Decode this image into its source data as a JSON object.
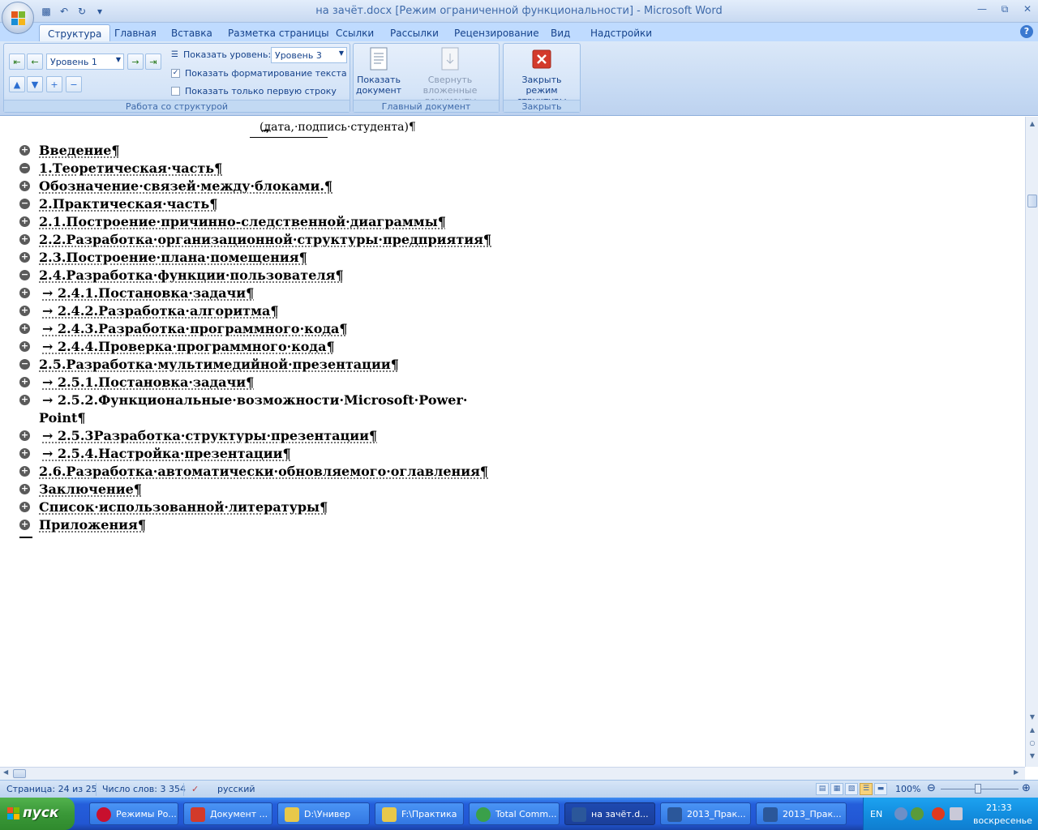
{
  "window": {
    "title": "на зачёт.docx [Режим ограниченной функциональности] - Microsoft Word",
    "controls": [
      "minimize",
      "restore",
      "close"
    ]
  },
  "quick_access": [
    "save-icon",
    "undo-icon",
    "redo-icon",
    "customize-icon"
  ],
  "tabs": [
    {
      "label": "Структура",
      "active": true
    },
    {
      "label": "Главная"
    },
    {
      "label": "Вставка"
    },
    {
      "label": "Разметка страницы"
    },
    {
      "label": "Ссылки"
    },
    {
      "label": "Рассылки"
    },
    {
      "label": "Рецензирование"
    },
    {
      "label": "Вид"
    },
    {
      "label": "Надстройки"
    }
  ],
  "ribbon": {
    "outline_group": {
      "label": "Работа со структурой",
      "level_select": "Уровень 1",
      "show_level_label": "Показать уровень:",
      "show_level_value": "Уровень 3",
      "show_formatting": {
        "label": "Показать форматирование текста",
        "checked": true
      },
      "first_line_only": {
        "label": "Показать только первую строку",
        "checked": false
      }
    },
    "master_group": {
      "label": "Главный документ",
      "show_document": "Показать документ",
      "collapse_subdocs": "Свернуть вложенные документы"
    },
    "close_group": {
      "label": "Закрыть",
      "close_outline": "Закрыть режим структуры"
    }
  },
  "document": {
    "caption": "(дата,·подпись·студента)¶",
    "items": [
      {
        "symbol": "plus",
        "text": "Введение¶"
      },
      {
        "symbol": "minus",
        "text": "1.Теоретическая·часть¶"
      },
      {
        "symbol": "plus",
        "text": "Обозначение·связей·между·блоками.¶"
      },
      {
        "symbol": "minus",
        "text": "2.Практическая·часть¶"
      },
      {
        "symbol": "plus",
        "text": "2.1.Построение·причинно-следственной·диаграммы¶"
      },
      {
        "symbol": "plus",
        "text": "2.2.Разработка·организационной·структуры·предприятия¶"
      },
      {
        "symbol": "plus",
        "text": "2.3.Построение·плана·помещения¶"
      },
      {
        "symbol": "minus",
        "text": "2.4.Разработка·функции·пользователя¶"
      },
      {
        "symbol": "plus",
        "text": "→ 2.4.1.Постановка·задачи¶"
      },
      {
        "symbol": "plus",
        "text": "→ 2.4.2.Разработка·алгоритма¶"
      },
      {
        "symbol": "plus",
        "text": "→ 2.4.3.Разработка·программного·кода¶"
      },
      {
        "symbol": "plus",
        "text": "→ 2.4.4.Проверка·программного·кода¶"
      },
      {
        "symbol": "minus",
        "text": "2.5.Разработка·мультимедийной·презентации¶"
      },
      {
        "symbol": "plus",
        "text": "→ 2.5.1.Постановка·задачи¶"
      },
      {
        "symbol": "plus",
        "text": "→ 2.5.2.Функциональные·возможности·Microsoft·Power·"
      },
      {
        "symbol": "none",
        "text": "Point¶"
      },
      {
        "symbol": "plus",
        "text": "→ 2.5.3Разработка·структуры·презентации¶"
      },
      {
        "symbol": "plus",
        "text": "→ 2.5.4.Настройка·презентации¶"
      },
      {
        "symbol": "plus",
        "text": "2.6.Разработка·автоматически·обновляемого·оглавления¶"
      },
      {
        "symbol": "plus",
        "text": "Заключение¶"
      },
      {
        "symbol": "plus",
        "text": "Список·использованной·литературы¶"
      },
      {
        "symbol": "plus",
        "text": "Приложения¶"
      }
    ]
  },
  "status": {
    "page": "Страница: 24 из 25",
    "words": "Число слов: 3 354",
    "language": "русский",
    "zoom": "100%",
    "zoom_percent": 100
  },
  "taskbar": {
    "start": "пуск",
    "tasks": [
      {
        "label": "Режимы Ро...",
        "icon": "opera-icon",
        "color": "#c8102e"
      },
      {
        "label": "Документ ...",
        "icon": "browser-icon",
        "color": "#d23a2a"
      },
      {
        "label": "D:\\Универ",
        "icon": "folder-icon",
        "color": "#e8c84a"
      },
      {
        "label": "F:\\Практика",
        "icon": "folder-icon",
        "color": "#e8c84a"
      },
      {
        "label": "Total Comm...",
        "icon": "total-commander-icon",
        "color": "#3aa04a"
      },
      {
        "label": "на зачёт.d...",
        "icon": "word-icon",
        "color": "#2b579a",
        "active": true
      },
      {
        "label": "2013_Прак...",
        "icon": "word-icon",
        "color": "#2b579a"
      },
      {
        "label": "2013_Прак...",
        "icon": "word-icon",
        "color": "#2b579a"
      }
    ],
    "lang": "EN",
    "time": "21:33",
    "day": "воскресенье"
  }
}
